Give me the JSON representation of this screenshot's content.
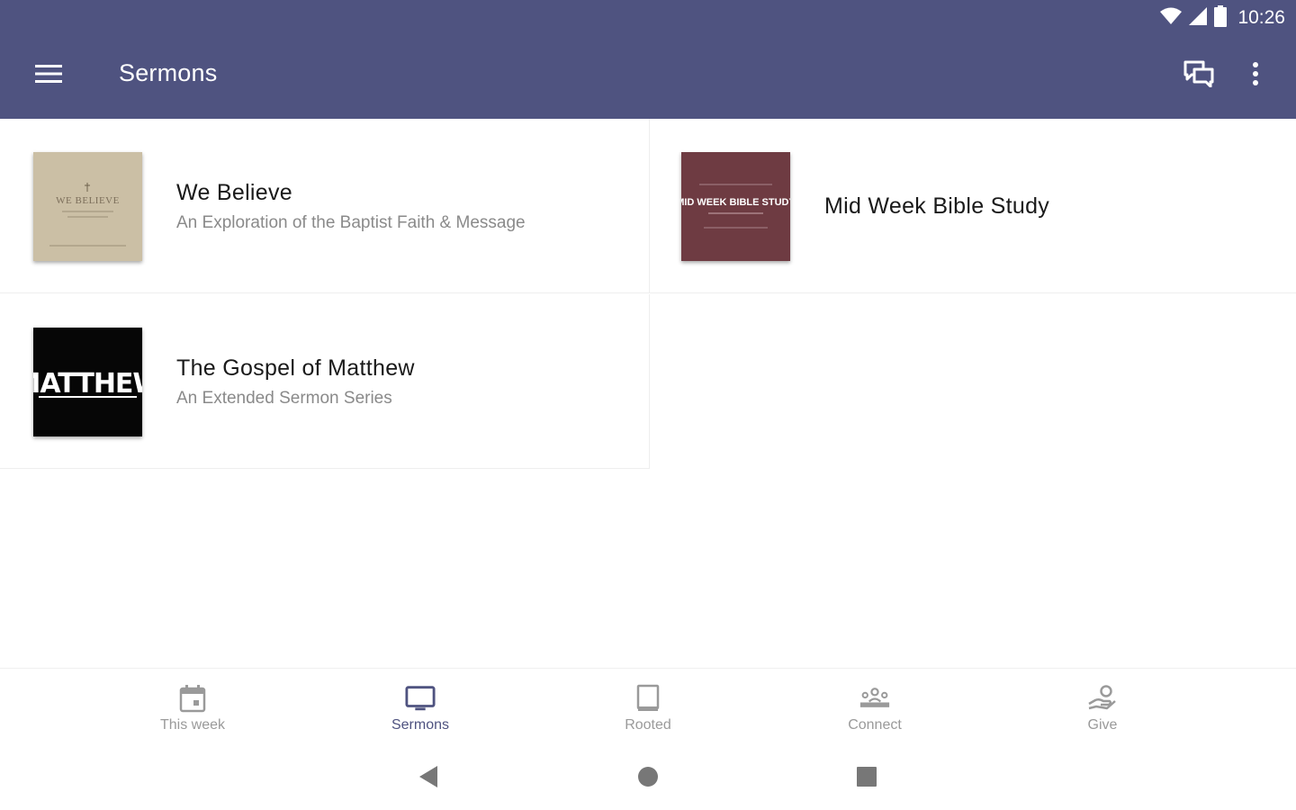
{
  "status_bar": {
    "time": "10:26"
  },
  "app_bar": {
    "title": "Sermons",
    "menu_icon": "hamburger-menu-icon",
    "chat_icon": "chat-bubbles-icon",
    "more_icon": "more-vert-icon"
  },
  "sermon_series": [
    {
      "title": "We Believe",
      "subtitle": "An Exploration of the Baptist Faith & Message",
      "thumbnail_text": "WE BELIEVE"
    },
    {
      "title": "Mid Week Bible Study",
      "subtitle": "",
      "thumbnail_text": "MID WEEK BIBLE STUDY"
    },
    {
      "title": "The Gospel of Matthew",
      "subtitle": "An Extended Sermon Series",
      "thumbnail_text": "MATTHEW"
    }
  ],
  "bottom_nav": [
    {
      "label": "This week",
      "icon": "calendar-icon"
    },
    {
      "label": "Sermons",
      "icon": "tv-icon",
      "active": true
    },
    {
      "label": "Rooted",
      "icon": "book-icon"
    },
    {
      "label": "Connect",
      "icon": "people-group-icon"
    },
    {
      "label": "Give",
      "icon": "hand-heart-icon"
    }
  ],
  "colors": {
    "app_bar": "#4f5380",
    "active_nav": "#4f5380",
    "inactive_nav": "#9a9a9a"
  }
}
